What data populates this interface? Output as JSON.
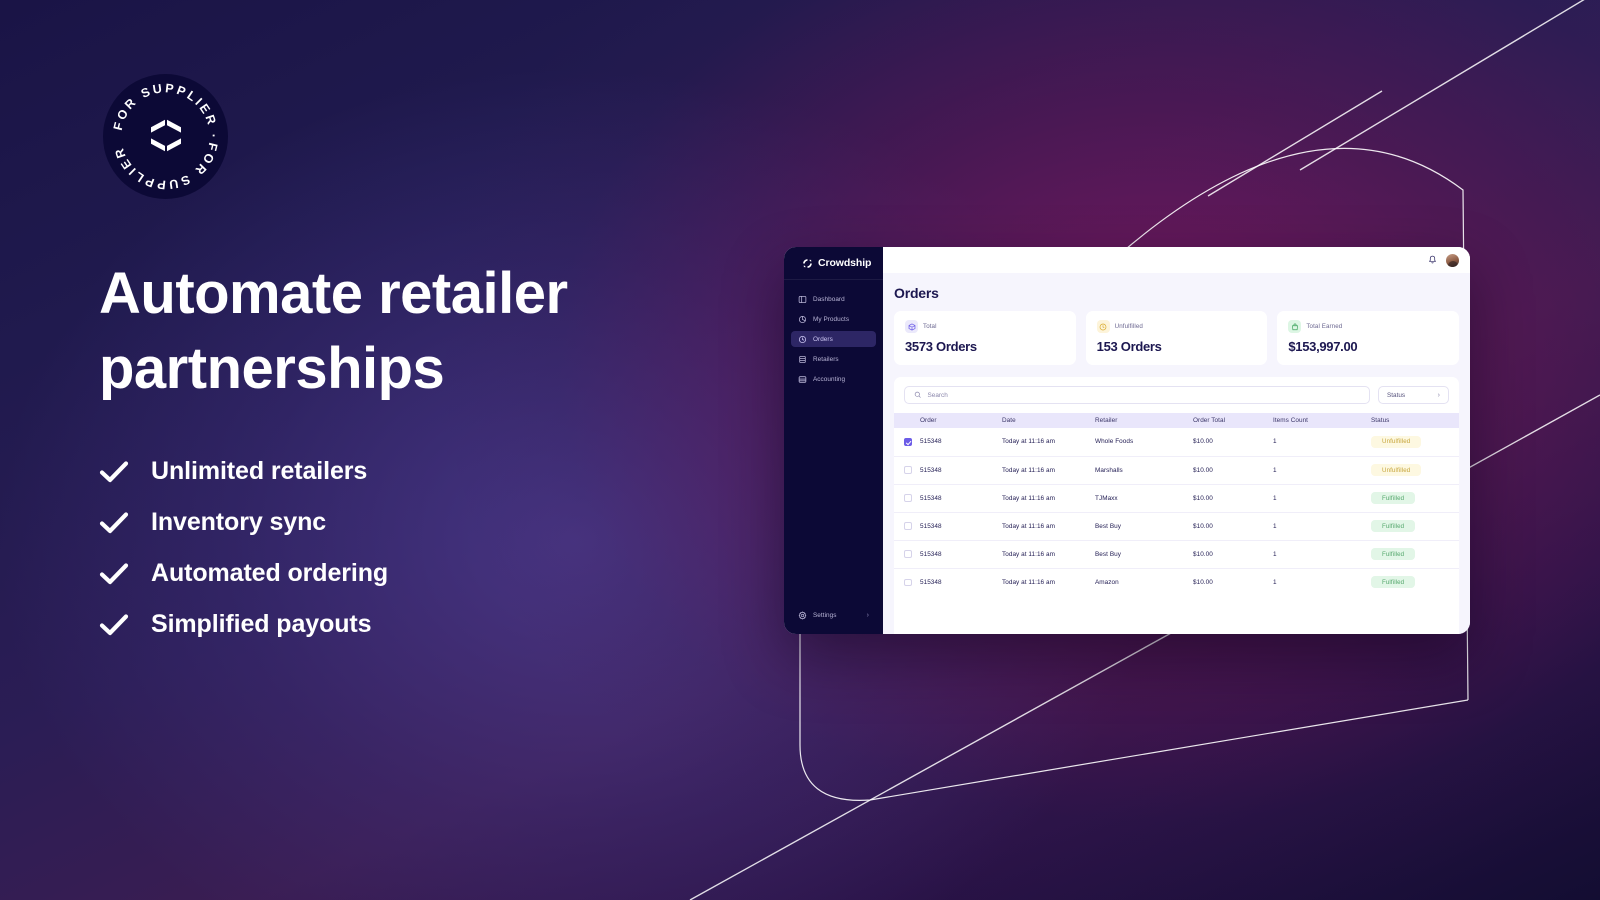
{
  "brandbadge": {
    "ring_text": "FOR SUPPLIER",
    "mark": "hexagon-logo"
  },
  "hero": {
    "headline": "Automate retailer partnerships",
    "features": [
      {
        "icon": "check-icon",
        "label": "Unlimited retailers"
      },
      {
        "icon": "check-icon",
        "label": "Inventory sync"
      },
      {
        "icon": "check-icon",
        "label": "Automated ordering"
      },
      {
        "icon": "check-icon",
        "label": "Simplified payouts"
      }
    ]
  },
  "app": {
    "brand": {
      "name": "Crowdship",
      "icon": "crowdship-logo-icon"
    },
    "sidebar": {
      "items": [
        {
          "label": "Dashboard",
          "icon": "dashboard-icon",
          "active": false
        },
        {
          "label": "My Products",
          "icon": "products-icon",
          "active": false
        },
        {
          "label": "Orders",
          "icon": "orders-icon",
          "active": true
        },
        {
          "label": "Retailers",
          "icon": "retailers-icon",
          "active": false
        },
        {
          "label": "Accounting",
          "icon": "accounting-icon",
          "active": false
        }
      ],
      "bottom": {
        "label": "Settings",
        "icon": "gear-icon",
        "chevron": "›"
      }
    },
    "topbar": {
      "notifications_icon": "bell-icon",
      "avatar": "user-avatar"
    },
    "page_title": "Orders",
    "stats": [
      {
        "label": "Total",
        "value": "3573 Orders",
        "icon": "box-icon",
        "accent": "#ebe9fb"
      },
      {
        "label": "Unfulfilled",
        "value": "153 Orders",
        "icon": "clock-icon",
        "accent": "#fdf4da"
      },
      {
        "label": "Total Earned",
        "value": "$153,997.00",
        "icon": "bag-icon",
        "accent": "#ddf6e4"
      }
    ],
    "toolbar": {
      "search_placeholder": "Search",
      "search_value": "",
      "search_icon": "search-icon",
      "status_filter_label": "Status",
      "status_filter_chevron": "›"
    },
    "table": {
      "columns": [
        "Order",
        "Date",
        "Retailer",
        "Order Total",
        "Items Count",
        "Status"
      ],
      "rows": [
        {
          "selected": true,
          "order": "515348",
          "date": "Today at 11:16 am",
          "retailer": "Whole Foods",
          "total": "$10.00",
          "items": "1",
          "status": "Unfulfilled",
          "status_kind": "unfulfilled"
        },
        {
          "selected": false,
          "order": "515348",
          "date": "Today at 11:16 am",
          "retailer": "Marshalls",
          "total": "$10.00",
          "items": "1",
          "status": "Unfulfilled",
          "status_kind": "unfulfilled"
        },
        {
          "selected": false,
          "order": "515348",
          "date": "Today at 11:16 am",
          "retailer": "TJMaxx",
          "total": "$10.00",
          "items": "1",
          "status": "Fulfilled",
          "status_kind": "fulfilled"
        },
        {
          "selected": false,
          "order": "515348",
          "date": "Today at 11:16 am",
          "retailer": "Best Buy",
          "total": "$10.00",
          "items": "1",
          "status": "Fulfilled",
          "status_kind": "fulfilled"
        },
        {
          "selected": false,
          "order": "515348",
          "date": "Today at 11:16 am",
          "retailer": "Best Buy",
          "total": "$10.00",
          "items": "1",
          "status": "Fulfilled",
          "status_kind": "fulfilled"
        },
        {
          "selected": false,
          "order": "515348",
          "date": "Today at 11:16 am",
          "retailer": "Amazon",
          "total": "$10.00",
          "items": "1",
          "status": "Fulfilled",
          "status_kind": "fulfilled"
        }
      ]
    }
  },
  "colors": {
    "brand_navy": "#0c0936",
    "accent_purple": "#6c5ce7",
    "bg_lavender": "#f6f5fd",
    "status_unfulfilled_text": "#c6a53a",
    "status_fulfilled_text": "#55a86d"
  }
}
